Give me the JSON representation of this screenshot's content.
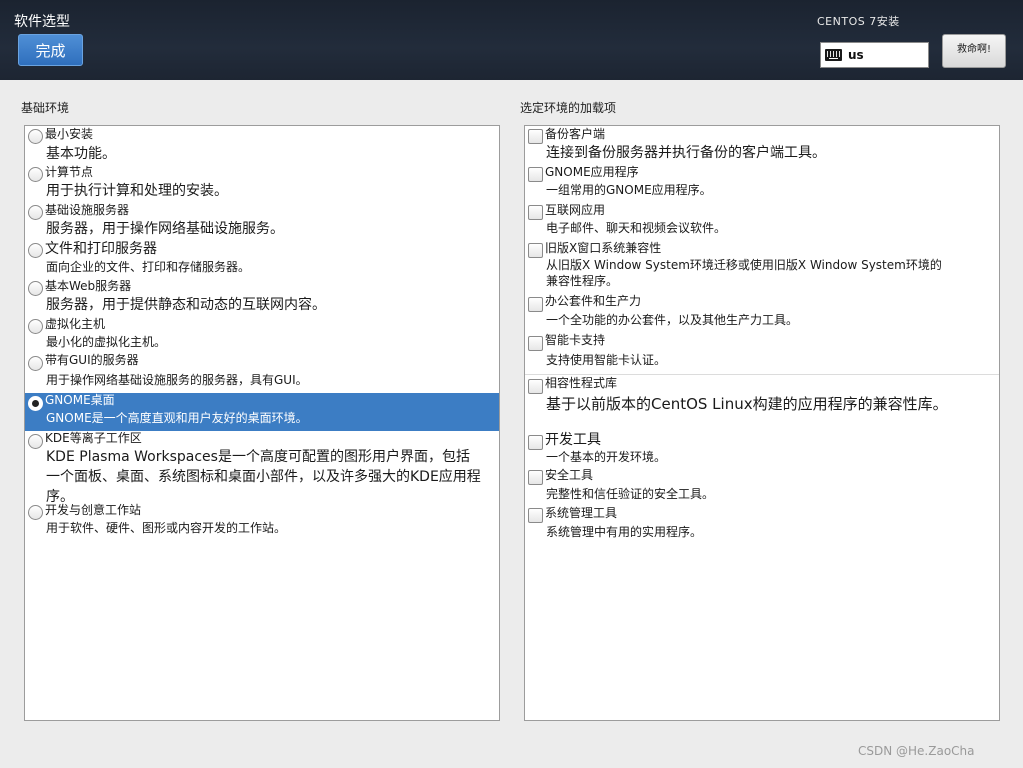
{
  "header": {
    "title": "软件选型",
    "done_label": "完成",
    "os_title": "CENTOS 7安装",
    "keyboard_layout": "us",
    "help_label": "救命啊!"
  },
  "left": {
    "label": "基础环境",
    "items": [
      {
        "title": "最小安装",
        "desc": "基本功能。",
        "selected": false
      },
      {
        "title": "计算节点",
        "desc": "用于执行计算和处理的安装。",
        "selected": false
      },
      {
        "title": "基础设施服务器",
        "desc": "服务器，用于操作网络基础设施服务。",
        "selected": false
      },
      {
        "title": "文件和打印服务器",
        "desc": "面向企业的文件、打印和存储服务器。",
        "selected": false
      },
      {
        "title": "基本Web服务器",
        "desc": "服务器，用于提供静态和动态的互联网内容。",
        "selected": false
      },
      {
        "title": "虚拟化主机",
        "desc": "最小化的虚拟化主机。",
        "selected": false
      },
      {
        "title": "带有GUI的服务器",
        "desc": "用于操作网络基础设施服务的服务器，具有GUI。",
        "selected": false
      },
      {
        "title": "GNOME桌面",
        "desc": "GNOME是一个高度直观和用户友好的桌面环境。",
        "selected": true
      },
      {
        "title": "KDE等离子工作区",
        "desc": "KDE Plasma Workspaces是一个高度可配置的图形用户界面，包括一个面板、桌面、系统图标和桌面小部件，以及许多强大的KDE应用程序。",
        "selected": false
      },
      {
        "title": "开发与创意工作站",
        "desc": "用于软件、硬件、图形或内容开发的工作站。",
        "selected": false
      }
    ]
  },
  "right": {
    "label": "选定环境的加载项",
    "items": [
      {
        "title": "备份客户端",
        "desc": "连接到备份服务器并执行备份的客户端工具。",
        "checked": false
      },
      {
        "title": "GNOME应用程序",
        "desc": "一组常用的GNOME应用程序。",
        "checked": false
      },
      {
        "title": "互联网应用",
        "desc": "电子邮件、聊天和视频会议软件。",
        "checked": false
      },
      {
        "title": "旧版X窗口系统兼容性",
        "desc": "从旧版X Window System环境迁移或使用旧版X Window System环境的兼容性程序。",
        "checked": false
      },
      {
        "title": "办公套件和生产力",
        "desc": "一个全功能的办公套件，以及其他生产力工具。",
        "checked": false
      },
      {
        "title": "智能卡支持",
        "desc": "支持使用智能卡认证。",
        "checked": false
      },
      {
        "title": "相容性程式库",
        "desc": "基于以前版本的CentOS Linux构建的应用程序的兼容性库。",
        "checked": false
      },
      {
        "title": "开发工具",
        "desc": "一个基本的开发环境。",
        "checked": false
      },
      {
        "title": "安全工具",
        "desc": "完整性和信任验证的安全工具。",
        "checked": false
      },
      {
        "title": "系统管理工具",
        "desc": "系统管理中有用的实用程序。",
        "checked": false
      }
    ]
  },
  "watermark": "CSDN @He.ZaoCha"
}
